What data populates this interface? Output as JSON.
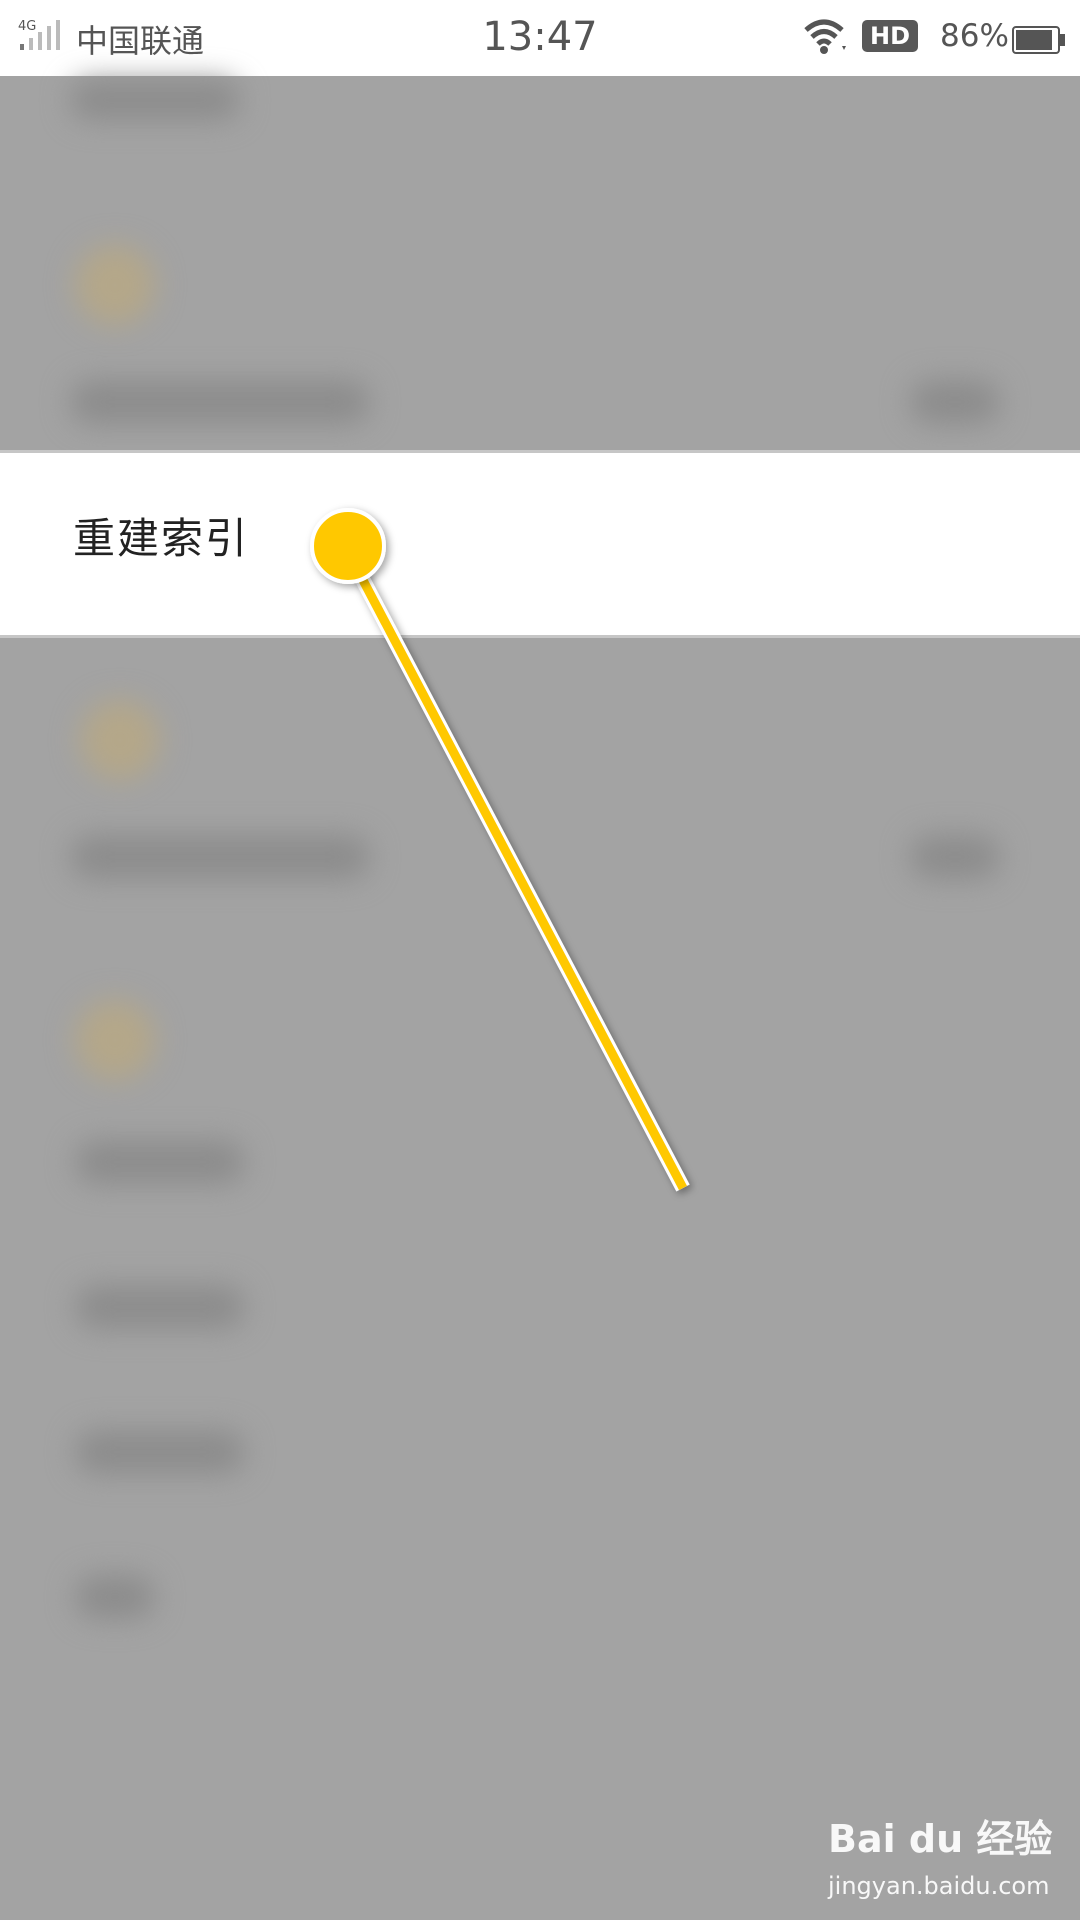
{
  "status_bar": {
    "network": "4G",
    "carrier": "中国联通",
    "time": "13:47",
    "hd": "HD",
    "battery_percent": "86%"
  },
  "highlight_row": {
    "label": "重建索引"
  },
  "watermark": {
    "brand": "Bai du 经验",
    "domain": "jingyan.baidu.com"
  },
  "colors": {
    "pointer": "#ffc800",
    "overlay": "#a3a3a3",
    "highlight": "#ffffff"
  },
  "icons": [
    "signal-icon",
    "wifi-icon",
    "battery-icon",
    "paw-icon"
  ]
}
